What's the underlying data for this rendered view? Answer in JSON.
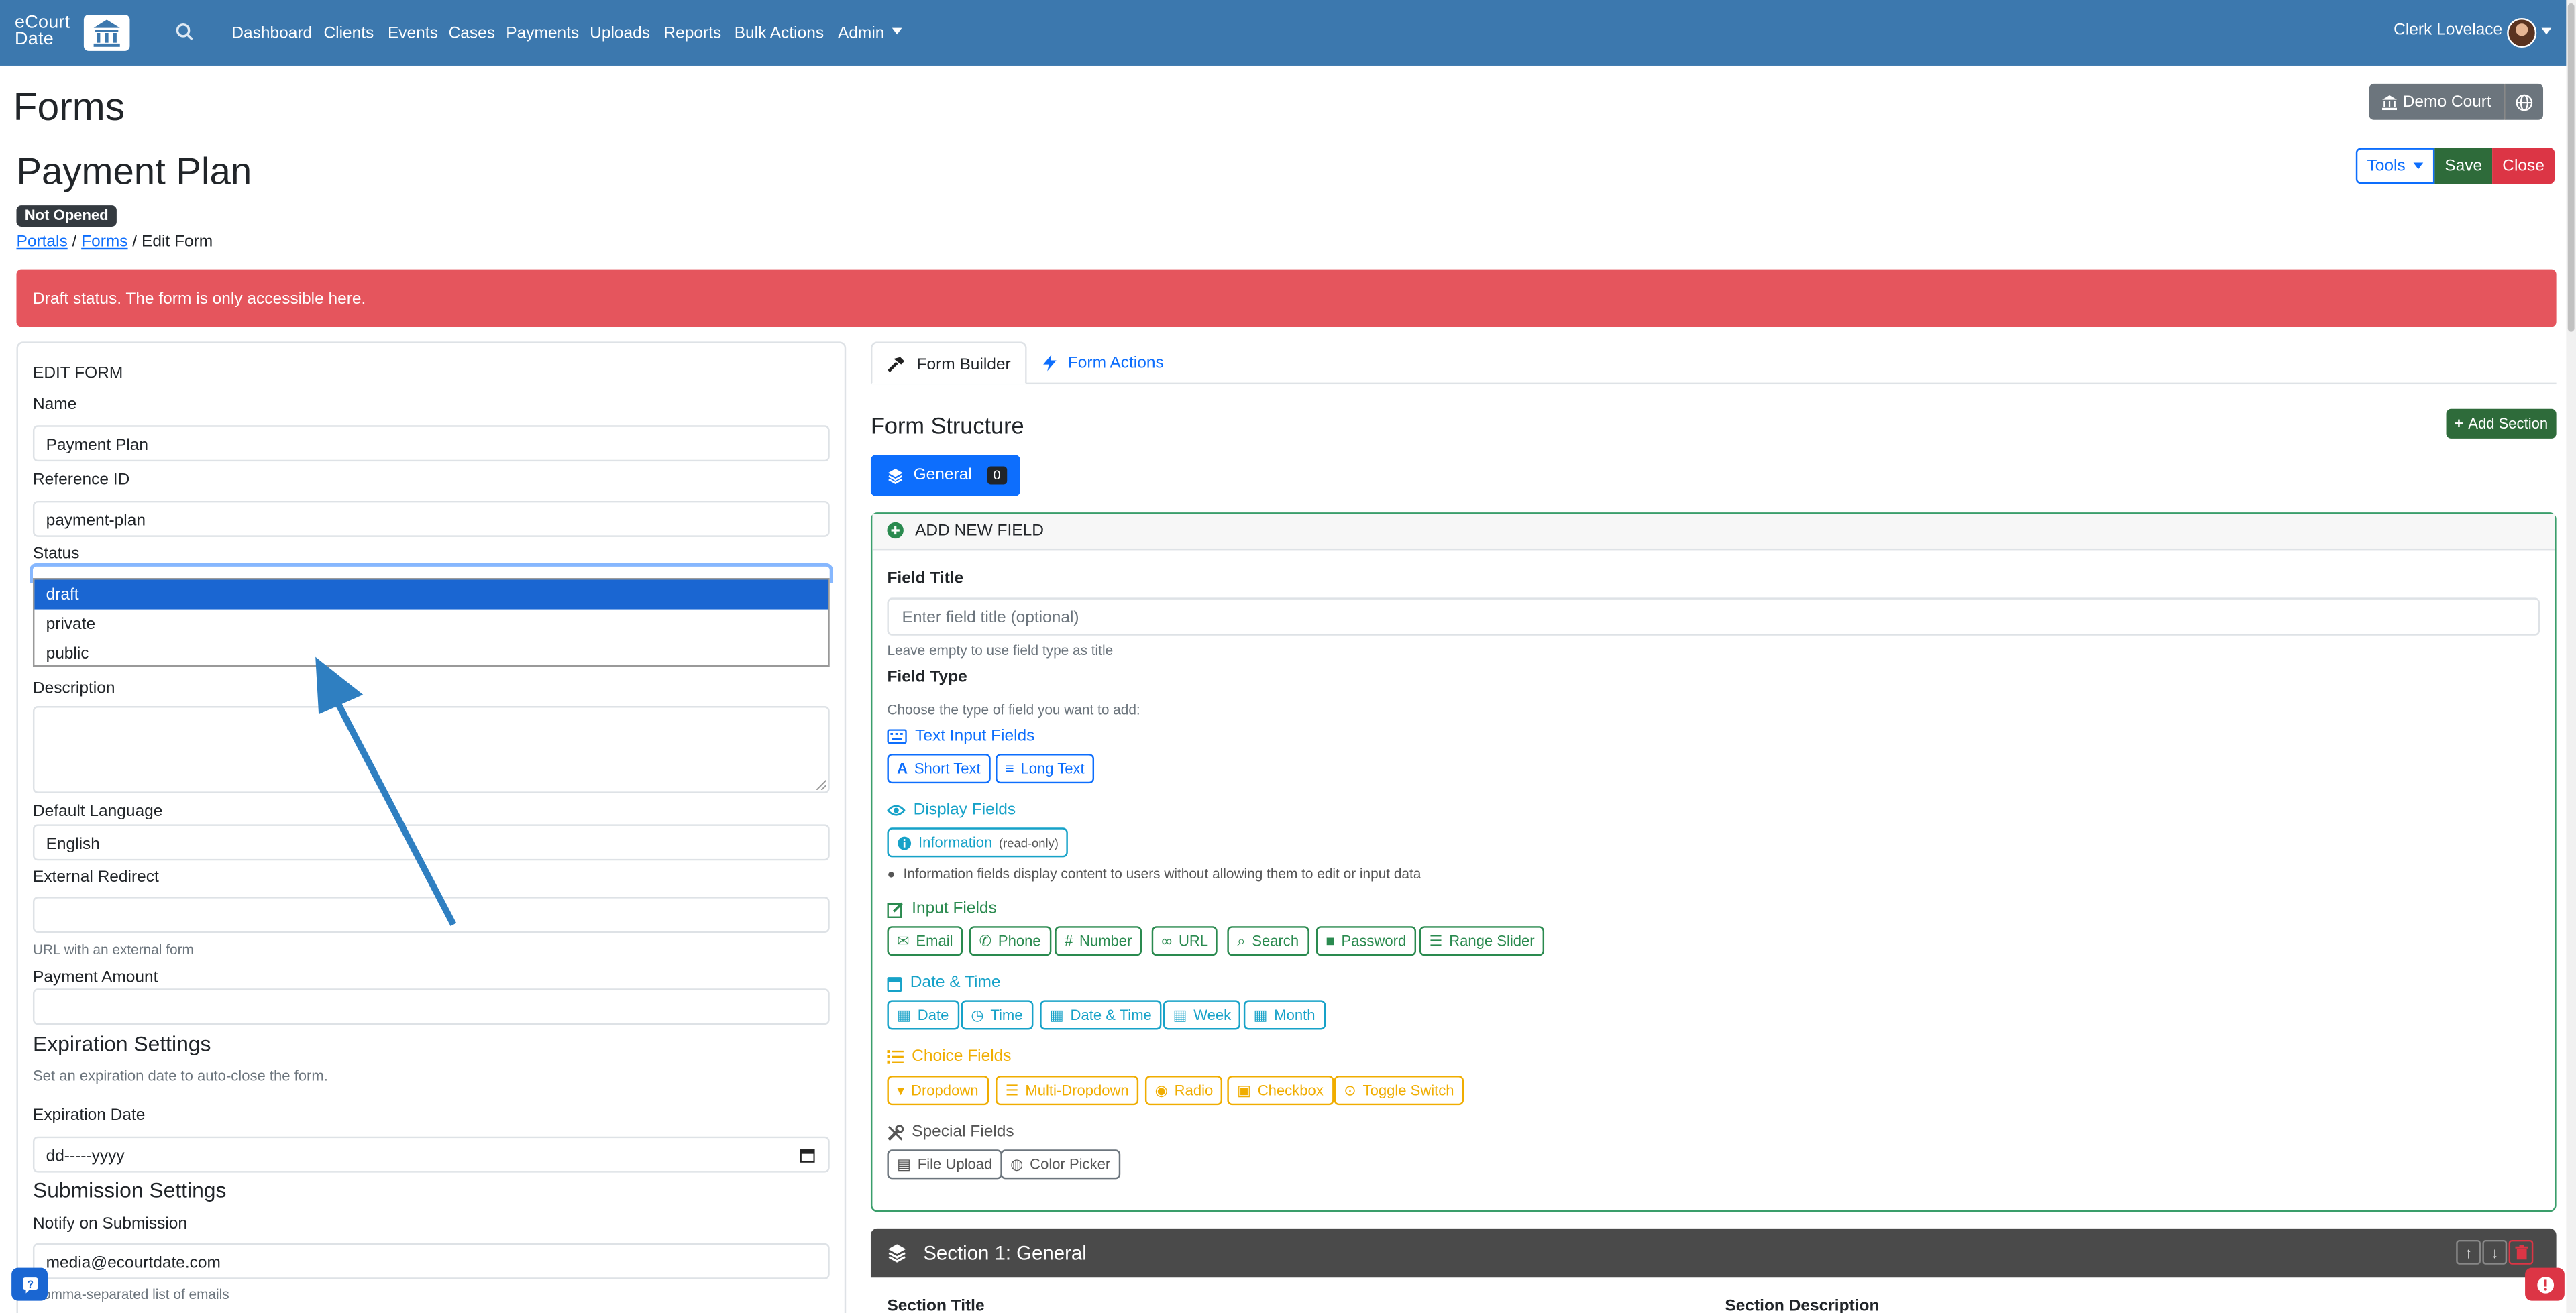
{
  "app": {
    "logo_line1": "eCourt",
    "logo_line2": "Date"
  },
  "nav": {
    "items": [
      "Dashboard",
      "Clients",
      "Events",
      "Cases",
      "Payments",
      "Uploads",
      "Reports",
      "Bulk Actions",
      "Admin"
    ],
    "user": "Clerk Lovelace"
  },
  "page": {
    "title": "Forms",
    "form_name": "Payment Plan",
    "status_badge": "Not Opened",
    "breadcrumb": {
      "portals": "Portals",
      "forms": "Forms",
      "current": "Edit Form"
    },
    "court_button": "Demo Court",
    "tools": "Tools",
    "save": "Save",
    "close": "Close",
    "alert": "Draft status. The form is only accessible here."
  },
  "edit_form": {
    "heading": "EDIT FORM",
    "name_label": "Name",
    "name_value": "Payment Plan",
    "ref_label": "Reference ID",
    "ref_value": "payment-plan",
    "status_label": "Status",
    "status_options": [
      "draft",
      "private",
      "public"
    ],
    "status_selected": "draft",
    "description_label": "Description",
    "language_label": "Default Language",
    "language_value": "English",
    "redirect_label": "External Redirect",
    "redirect_help": "URL with an external form",
    "payment_label": "Payment Amount",
    "expiration_heading": "Expiration Settings",
    "expiration_help": "Set an expiration date to auto-close the form.",
    "expiration_label": "Expiration Date",
    "expiration_value": "dd-----yyyy",
    "submission_heading": "Submission Settings",
    "notify_label": "Notify on Submission",
    "notify_value": "media@ecourtdate.com",
    "notify_help": "Comma-separated list of emails"
  },
  "builder": {
    "tab_builder": "Form Builder",
    "tab_actions": "Form Actions",
    "structure_title": "Form Structure",
    "add_section": "Add Section",
    "general_tab": "General",
    "general_count": "0",
    "add_field_heading": "ADD NEW FIELD",
    "field_title_label": "Field Title",
    "field_title_placeholder": "Enter field title (optional)",
    "field_title_help": "Leave empty to use field type as title",
    "field_type_label": "Field Type",
    "field_type_help": "Choose the type of field you want to add:",
    "groups": {
      "text": {
        "title": "Text Input Fields",
        "buttons": [
          "Short Text",
          "Long Text"
        ]
      },
      "display": {
        "title": "Display Fields",
        "info_button": "Information",
        "info_suffix": "(read-only)",
        "note": "Information fields display content to users without allowing them to edit or input data"
      },
      "input": {
        "title": "Input Fields",
        "buttons": [
          "Email",
          "Phone",
          "Number",
          "URL",
          "Search",
          "Password",
          "Range Slider"
        ]
      },
      "datetime": {
        "title": "Date & Time",
        "buttons": [
          "Date",
          "Time",
          "Date & Time",
          "Week",
          "Month"
        ]
      },
      "choice": {
        "title": "Choice Fields",
        "buttons": [
          "Dropdown",
          "Multi-Dropdown",
          "Radio",
          "Checkbox",
          "Toggle Switch"
        ]
      },
      "special": {
        "title": "Special Fields",
        "buttons": [
          "File Upload",
          "Color Picker"
        ]
      }
    },
    "section_title": "Section 1: General",
    "section_title_label": "Section Title",
    "section_desc_label": "Section Description"
  },
  "colors": {
    "nav": "#3c78ae",
    "save": "#2e6b3a",
    "close": "#dc3545",
    "alert": "#e5555d",
    "primary": "#0d6efd",
    "info": "#17a2c8",
    "success": "#2a8a4f",
    "warning": "#f0ad00"
  }
}
